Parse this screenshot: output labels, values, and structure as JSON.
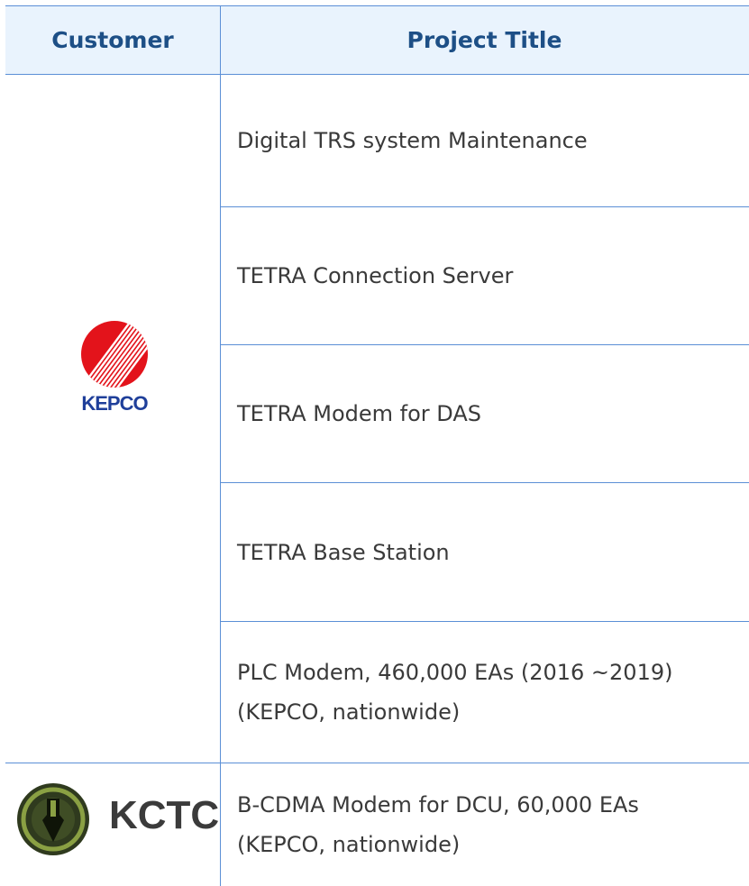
{
  "table": {
    "headers": {
      "customer": "Customer",
      "project_title": "Project Title"
    },
    "rows": [
      {
        "customer_logo": "KEPCO",
        "project": [
          "Digital TRS system Maintenance"
        ]
      },
      {
        "customer_logo": "KEPCO",
        "project": [
          "TETRA Connection Server"
        ]
      },
      {
        "customer_logo": "KEPCO",
        "project": [
          "TETRA Modem for DAS"
        ]
      },
      {
        "customer_logo": "KEPCO",
        "project": [
          "TETRA Base Station"
        ]
      },
      {
        "customer_logo": "KEPCO",
        "project": [
          "PLC Modem,  460,000 EAs (2016 ~2019)",
          "(KEPCO, nationwide)"
        ]
      },
      {
        "customer_logo": "KCTC",
        "project": [
          "B-CDMA Modem for DCU,  60,000 EAs",
          "(KEPCO, nationwide)"
        ]
      }
    ]
  },
  "logos": {
    "kepco": {
      "name": "KEPCO",
      "color": "#e3131b",
      "text_color": "#1f3f9a"
    },
    "kctc": {
      "name": "KCTC",
      "ring_color": "#8aa043",
      "text_color": "#3b3b3b"
    }
  },
  "colors": {
    "border": "#5b8fd6",
    "header_bg": "#e9f3fd",
    "header_text": "#1d4f86",
    "cell_text": "#3a3a3a"
  }
}
